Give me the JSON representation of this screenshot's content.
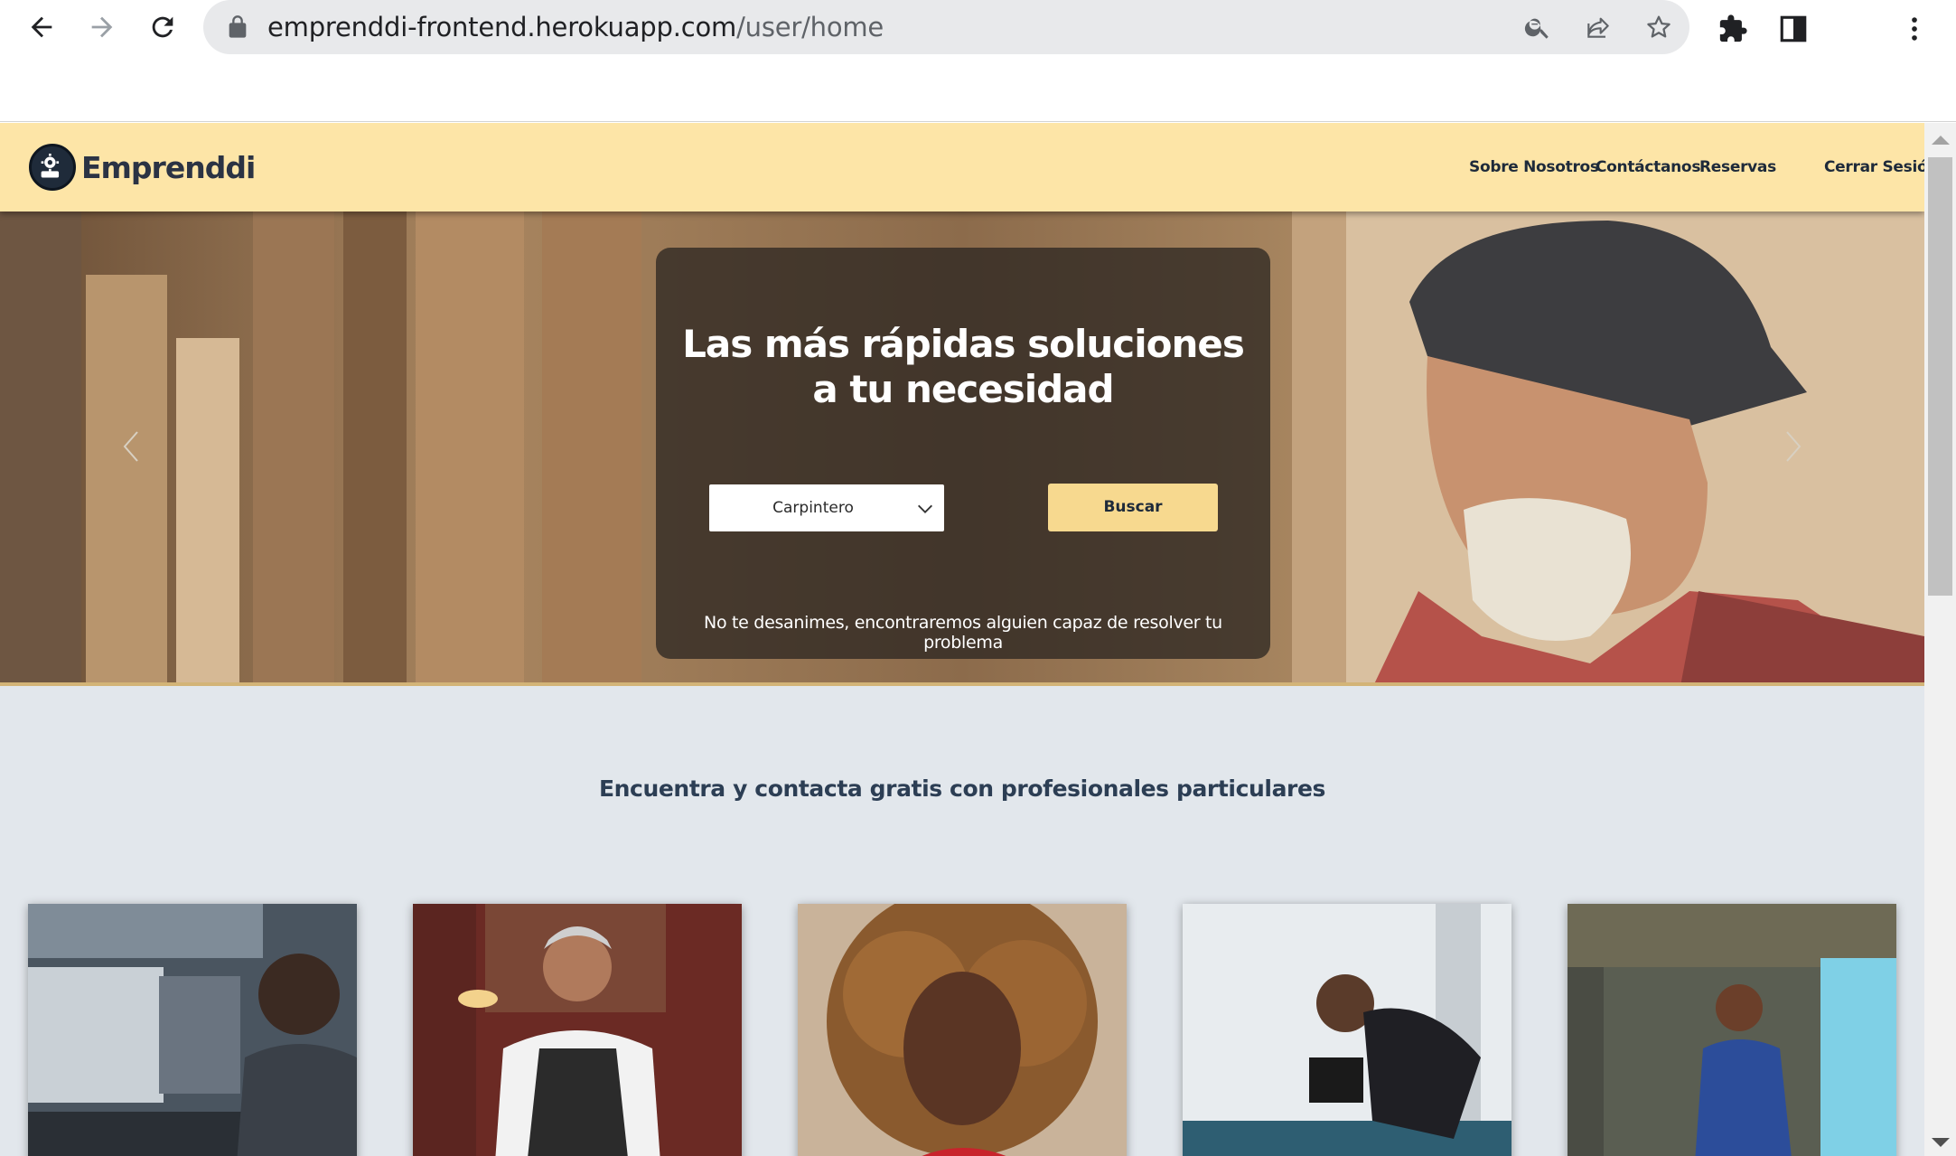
{
  "browser": {
    "url_host": "emprenddi-frontend.herokuapp.com",
    "url_path": "/user/home"
  },
  "site": {
    "brand": "Emprenddi",
    "nav": [
      "Sobre Nosotros",
      "Contáctanos",
      "Reservas"
    ],
    "logout": "Cerrar Sesión"
  },
  "hero": {
    "title": "Las más rápidas soluciones a tu necesidad",
    "select_value": "Carpintero",
    "search_button": "Buscar",
    "note": "No te desanimes, encontraremos alguien capaz de resolver tu problema"
  },
  "section": {
    "title": "Encuentra y contacta gratis con profesionales particulares"
  },
  "colors": {
    "header_bg": "#fde5a7",
    "accent": "#f7d98f",
    "text_dark": "#1e2a3a",
    "page_bg": "#e2e7ec"
  }
}
